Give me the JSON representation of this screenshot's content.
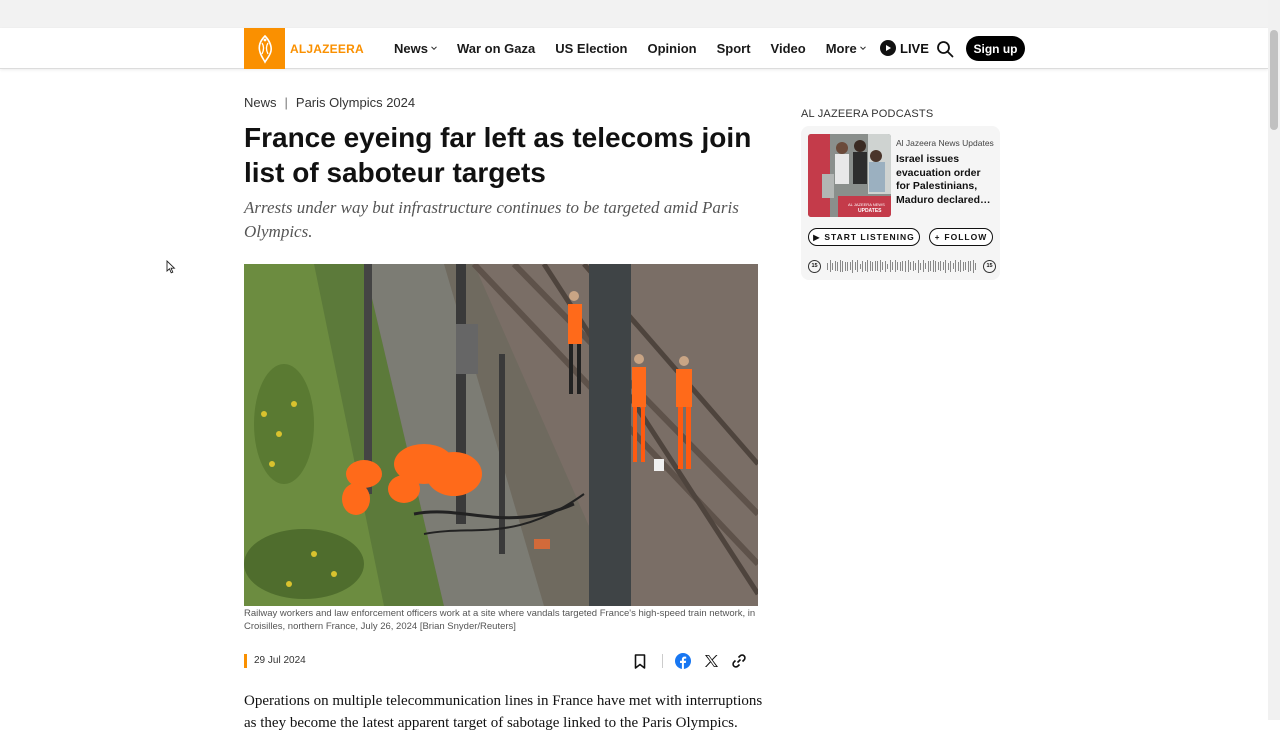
{
  "header": {
    "logo_text": "ALJAZEERA",
    "nav": [
      {
        "label": "News",
        "dropdown": true
      },
      {
        "label": "War on Gaza",
        "dropdown": false
      },
      {
        "label": "US Election",
        "dropdown": false
      },
      {
        "label": "Opinion",
        "dropdown": false
      },
      {
        "label": "Sport",
        "dropdown": false
      },
      {
        "label": "Video",
        "dropdown": false
      },
      {
        "label": "More",
        "dropdown": true
      }
    ],
    "live_label": "LIVE",
    "signup_label": "Sign up",
    "brand_color": "#fa9000"
  },
  "article": {
    "breadcrumb": [
      "News",
      "Paris Olympics 2024"
    ],
    "headline": "France eyeing far left as telecoms join list of saboteur targets",
    "dek": "Arrests under way but infrastructure continues to be targeted amid Paris Olympics.",
    "image_caption": "Railway workers and law enforcement officers work at a site where vandals targeted France's high-speed train network, in Croisilles, northern France, July 26, 2024 [Brian Snyder/Reuters]",
    "date": "29 Jul 2024",
    "body_first_line": "Operations on multiple telecommunication lines in France have met with interruptions as they become the latest apparent target of sabotage linked to the Paris Olympics."
  },
  "share_icons": [
    "bookmark-icon",
    "facebook-icon",
    "x-icon",
    "link-icon"
  ],
  "podcasts": {
    "section_label": "AL JAZEERA PODCASTS",
    "show_name": "Al Jazeera News Updates",
    "episode_title": "Israel issues evacuation order for Palestinians, Maduro declared…",
    "thumb_badge_line1": "AL JAZEERA NEWS",
    "thumb_badge_line2": "UPDATES",
    "listen_label": "START LISTENING",
    "follow_label": "FOLLOW",
    "skip_back_label": "15",
    "skip_forward_label": "15"
  }
}
